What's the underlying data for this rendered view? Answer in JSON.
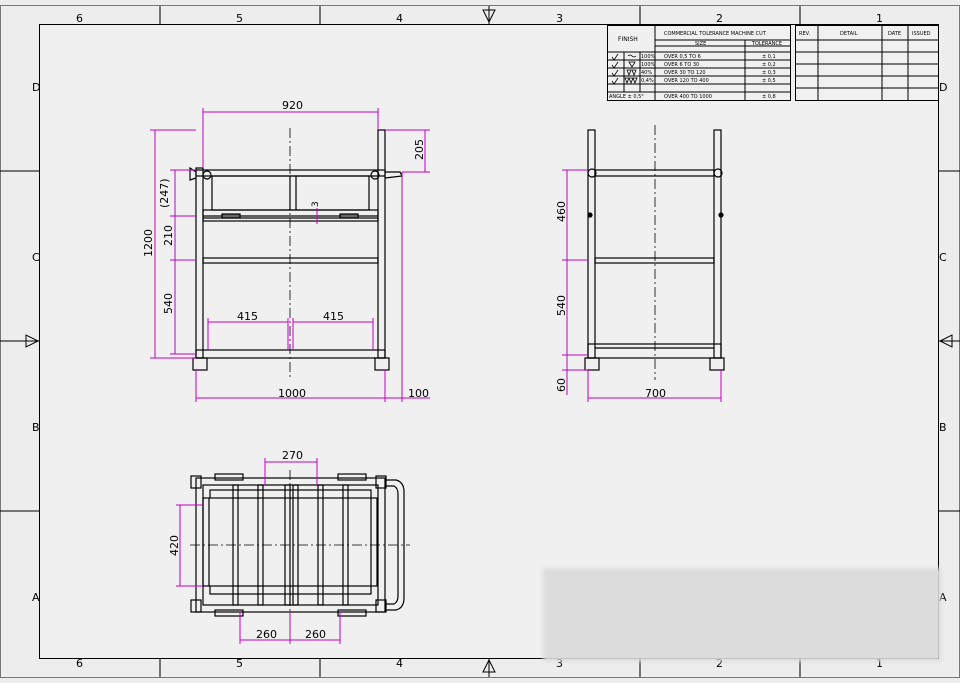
{
  "grid": {
    "cols_top": [
      "6",
      "5",
      "4",
      "3",
      "2",
      "1"
    ],
    "cols_bottom": [
      "6",
      "5",
      "4",
      "3",
      "2",
      "1"
    ],
    "rows_left": [
      "D",
      "C",
      "B",
      "A"
    ],
    "rows_right": [
      "D",
      "C",
      "B",
      "A"
    ]
  },
  "tolerance_table": {
    "finish_label": "FINISH",
    "title": "COMMERCIAL TOLERANCE MACHINE CUT",
    "size_header": "SIZE",
    "tolerance_header": "TOLERANCE",
    "rows": [
      {
        "pct": "100%",
        "size": "OVER 0,5 TO 6",
        "tol": "± 0,1"
      },
      {
        "pct": "100%",
        "size": "OVER 6 TO 30",
        "tol": "± 0,2"
      },
      {
        "pct": "40%",
        "size": "OVER 30 TO 120",
        "tol": "± 0,3"
      },
      {
        "pct": "0,4%",
        "size": "OVER 120 TO 400",
        "tol": "± 0,5"
      },
      {
        "pct": "ANGLE ± 0,5°",
        "size": "OVER 400 TO 1000",
        "tol": "± 0,8"
      }
    ]
  },
  "revision_table": {
    "headers": [
      "REV.",
      "DETAIL",
      "DATE",
      "ISSUED"
    ]
  },
  "front_view": {
    "dims": {
      "top_width": "920",
      "top_ext": "205",
      "upper_ref": "(247)",
      "mid_210": "210",
      "total_height": "1200",
      "lower_540": "540",
      "gap_3": "3",
      "half_left": "415",
      "half_right": "415",
      "base_width": "1000",
      "offset_100": "100"
    }
  },
  "side_view": {
    "dims": {
      "h460": "460",
      "h540": "540",
      "h60": "60",
      "w700": "700"
    }
  },
  "top_view": {
    "dims": {
      "w270": "270",
      "h420": "420",
      "w260a": "260",
      "w260b": "260"
    }
  },
  "colors": {
    "background": "#ededed",
    "border_fill": "#f0f0f0",
    "line": "#000000",
    "dimension": "#c000c0",
    "center_line": "#000000"
  }
}
